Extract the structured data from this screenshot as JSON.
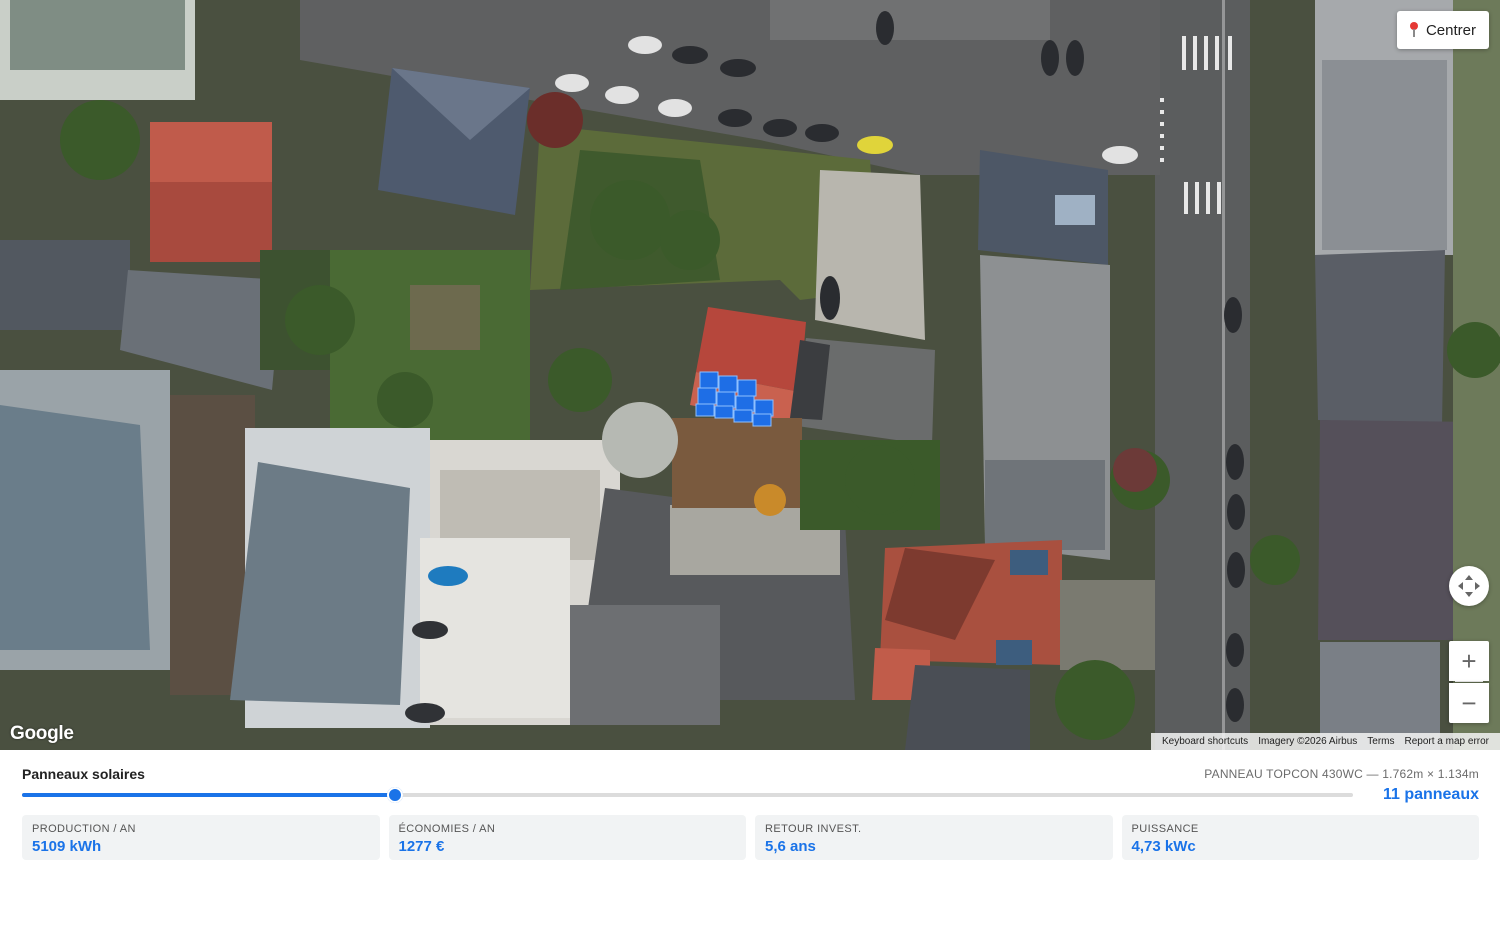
{
  "map": {
    "centre_button_label": "Centrer",
    "logo_text": "Google",
    "attribution": {
      "shortcuts": "Keyboard shortcuts",
      "imagery": "Imagery ©2026 Airbus",
      "terms": "Terms",
      "report": "Report a map error"
    },
    "controls": {
      "pan_icon": "pan-arrows-icon",
      "zoom_in_label": "+",
      "zoom_out_label": "−"
    },
    "panel_color": "#1e6ee6"
  },
  "panel": {
    "title": "Panneaux solaires",
    "spec": "PANNEAU TOPCON 430WC — 1.762m × 1.134m",
    "slider_fraction": 0.28,
    "count_label": "11 panneaux",
    "stats": [
      {
        "label": "PRODUCTION / AN",
        "value": "5109 kWh"
      },
      {
        "label": "ÉCONOMIES / AN",
        "value": "1277 €"
      },
      {
        "label": "RETOUR INVEST.",
        "value": "5,6 ans"
      },
      {
        "label": "PUISSANCE",
        "value": "4,73 kWc"
      }
    ],
    "accent_color": "#1a73e8"
  }
}
